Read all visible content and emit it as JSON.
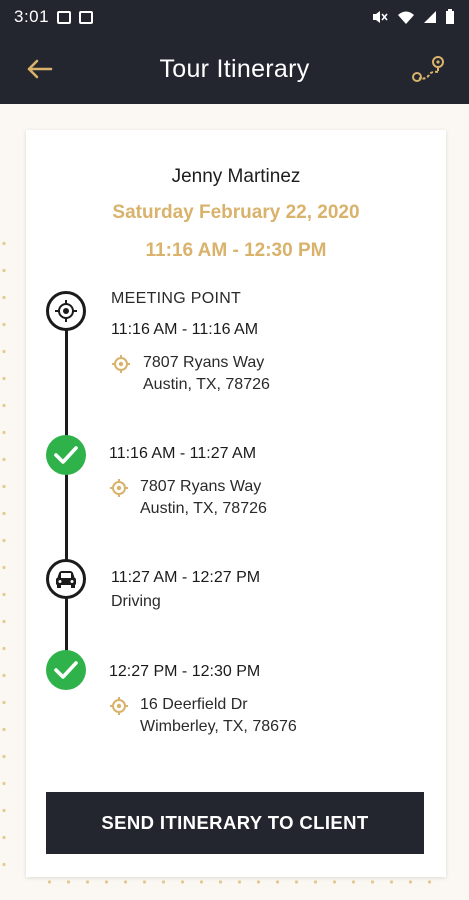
{
  "status_bar": {
    "time": "3:01"
  },
  "app_bar": {
    "title": "Tour Itinerary",
    "back_icon": "arrow-left-icon",
    "route_icon": "route-map-icon"
  },
  "colors": {
    "header": "#23262e",
    "accent": "#d9b26b",
    "success": "#2fb24a",
    "background": "#fbf7f2"
  },
  "summary": {
    "client_name": "Jenny Martinez",
    "date": "Saturday February 22, 2020",
    "time_range": "11:16 AM - 12:30 PM"
  },
  "stops": [
    {
      "icon": "target-icon",
      "label": "MEETING POINT",
      "time": "11:16 AM - 11:16 AM",
      "address_line1": "7807  Ryans Way",
      "address_line2": "Austin, TX, 78726"
    },
    {
      "icon": "checkmark-icon",
      "time": "11:16 AM - 11:27 AM",
      "address_line1": "7807  Ryans Way",
      "address_line2": "Austin, TX, 78726"
    },
    {
      "icon": "car-icon",
      "time": "11:27 AM - 12:27 PM",
      "status": "Driving"
    },
    {
      "icon": "checkmark-icon",
      "time": "12:27 PM - 12:30 PM",
      "address_line1": "16  Deerfield Dr",
      "address_line2": "Wimberley, TX, 78676"
    }
  ],
  "actions": {
    "send_label": "SEND ITINERARY TO CLIENT"
  }
}
